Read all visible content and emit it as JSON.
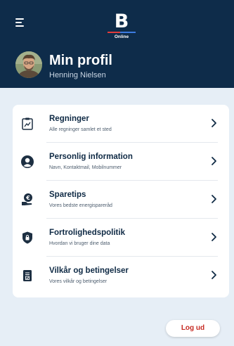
{
  "header": {
    "menu_icon": "hamburger-menu-icon",
    "logo": {
      "letter": "B",
      "sub": "Online"
    },
    "title": "Min profil",
    "user_name": "Henning Nielsen"
  },
  "menu_items": [
    {
      "title": "Regninger",
      "subtitle": "Alle regninger samlet et sted",
      "icon": "clipboard-chart-icon"
    },
    {
      "title": "Personlig information",
      "subtitle": "Navn, Kontaktmail, Mobilnummer",
      "icon": "user-circle-icon"
    },
    {
      "title": "Sparetips",
      "subtitle": "Vores bedste energispareråd",
      "icon": "hand-euro-coin-icon"
    },
    {
      "title": "Fortrolighedspolitik",
      "subtitle": "Hvordan vi bruger dine data",
      "icon": "shield-lock-icon"
    },
    {
      "title": "Vilkår og betingelser",
      "subtitle": "Vores vilkår og betingelser",
      "icon": "document-check-icon"
    }
  ],
  "logout": {
    "label": "Log ud"
  },
  "colors": {
    "header_bg": "#0e2c4a",
    "page_bg": "#e6eef6",
    "card_bg": "#ffffff",
    "text_primary": "#0f2a45",
    "logout_text": "#c62a22"
  }
}
